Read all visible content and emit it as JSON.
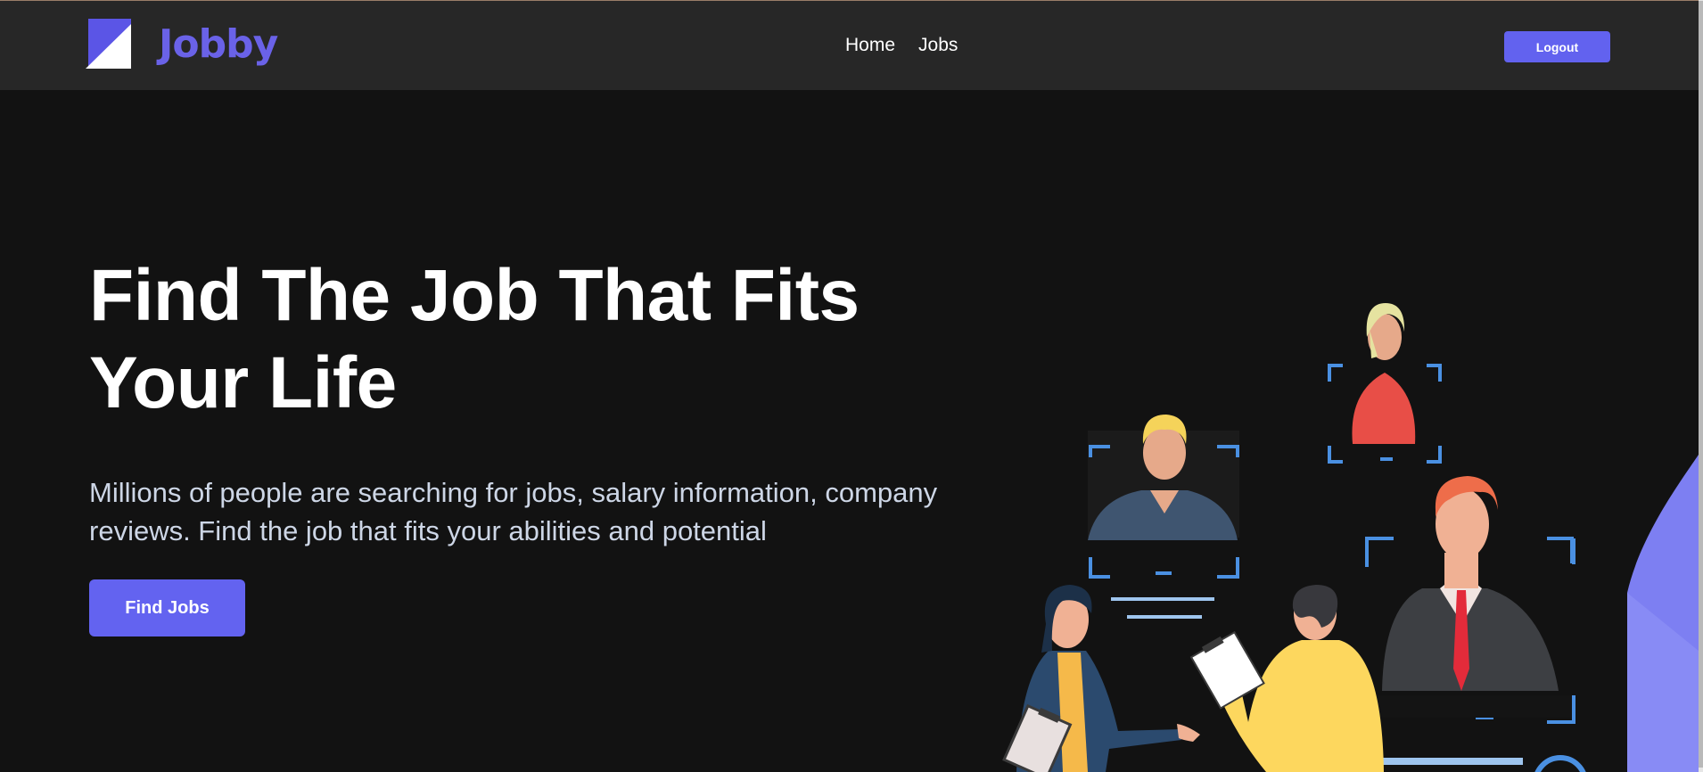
{
  "navbar": {
    "brand": "Jobby",
    "logo_icon": "jobby-logo",
    "links": [
      "Home",
      "Jobs"
    ],
    "logout_label": "Logout"
  },
  "hero": {
    "title": "Find The Job That Fits Your Life",
    "description": "Millions of people are searching for jobs, salary information, company reviews. Find the job that fits your abilities and potential",
    "cta_label": "Find Jobs"
  },
  "colors": {
    "background": "#121212",
    "navbar": "#272727",
    "accent": "#6262ef",
    "brand": "#6a62e8",
    "frame_blue": "#4a90e2"
  }
}
